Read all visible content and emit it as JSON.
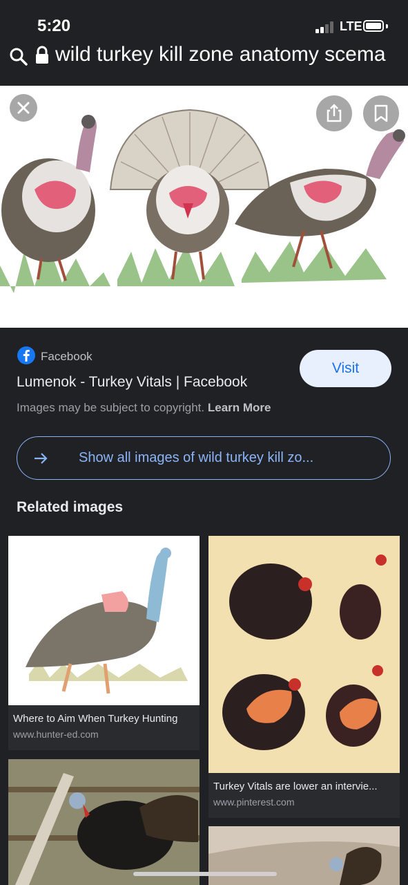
{
  "status": {
    "time": "5:20",
    "network": "LTE"
  },
  "address_bar": {
    "url_text": "wild turkey kill zone anatomy scema"
  },
  "result": {
    "source": "Facebook",
    "title": "Lumenok - Turkey Vitals | Facebook",
    "visit_label": "Visit",
    "copyright_text": "Images may be subject to copyright.",
    "learn_more": "Learn More",
    "show_all_label": "Show all images of wild turkey kill zo..."
  },
  "related": {
    "heading": "Related images",
    "items": [
      {
        "title": "Where to Aim When Turkey Hunting",
        "domain": "www.hunter-ed.com"
      },
      {
        "title": "Turkey Vitals are lower an intervie...",
        "domain": "www.pinterest.com"
      }
    ]
  },
  "icons": [
    "search-icon",
    "lock-icon",
    "close-icon",
    "share-icon",
    "bookmark-icon",
    "facebook-icon",
    "arrow-right-icon"
  ],
  "colors": {
    "background": "#202124",
    "accent": "#8ab4f8",
    "visit_bg": "#e8f0fe",
    "visit_text": "#1a73e8"
  }
}
